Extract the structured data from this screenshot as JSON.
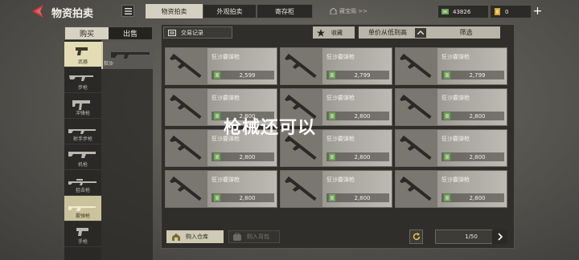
{
  "header": {
    "title": "物资拍卖",
    "tabs": [
      {
        "label": "物资拍卖",
        "active": true
      },
      {
        "label": "外观拍卖",
        "active": false
      },
      {
        "label": "寄存柜",
        "active": false
      }
    ],
    "treasure_link": "藏宝阁 >>",
    "currency_1": "43826",
    "currency_2": "0"
  },
  "sidebar": {
    "segments": [
      {
        "label": "购买",
        "active": true
      },
      {
        "label": "出售",
        "active": false
      }
    ],
    "categories": [
      {
        "label": "武器",
        "selected": true
      },
      {
        "label": "步枪",
        "selected": false
      },
      {
        "label": "冲锋枪",
        "selected": false
      },
      {
        "label": "射手步枪",
        "selected": false
      },
      {
        "label": "机枪",
        "selected": false
      },
      {
        "label": "狙击枪",
        "selected": false
      },
      {
        "label": "霰弹枪",
        "selected": true
      },
      {
        "label": "手枪",
        "selected": false
      }
    ],
    "sub_item": "狂沙"
  },
  "toolbar": {
    "trade_record": "交易记录",
    "favorite": "收藏",
    "sort": "单价从低到高",
    "filter": "筛选"
  },
  "items": [
    {
      "name": "狂沙霰弹枪",
      "price": "2,599"
    },
    {
      "name": "狂沙霰弹枪",
      "price": "2,799"
    },
    {
      "name": "狂沙霰弹枪",
      "price": "2,799"
    },
    {
      "name": "狂沙霰弹枪",
      "price": "2,800"
    },
    {
      "name": "狂沙霰弹枪",
      "price": "2,800"
    },
    {
      "name": "狂沙霰弹枪",
      "price": "2,800"
    },
    {
      "name": "狂沙霰弹枪",
      "price": "2,800"
    },
    {
      "name": "狂沙霰弹枪",
      "price": "2,800"
    },
    {
      "name": "狂沙霰弹枪",
      "price": "2,800"
    },
    {
      "name": "狂沙霰弹枪",
      "price": "2,800"
    },
    {
      "name": "狂沙霰弹枪",
      "price": "2,800"
    },
    {
      "name": "狂沙霰弹枪",
      "price": "2,800"
    }
  ],
  "overlay_caption": "枪械还可以",
  "footer": {
    "buy_to_warehouse": "购入仓库",
    "buy_to_backpack": "购入背包",
    "page_indicator": "1/50"
  },
  "colors": {
    "accent_red": "#d8383a",
    "active_tab": "#d5d1c2",
    "selected_category": "#e3dcb4",
    "money_green": "#6fa35c"
  }
}
